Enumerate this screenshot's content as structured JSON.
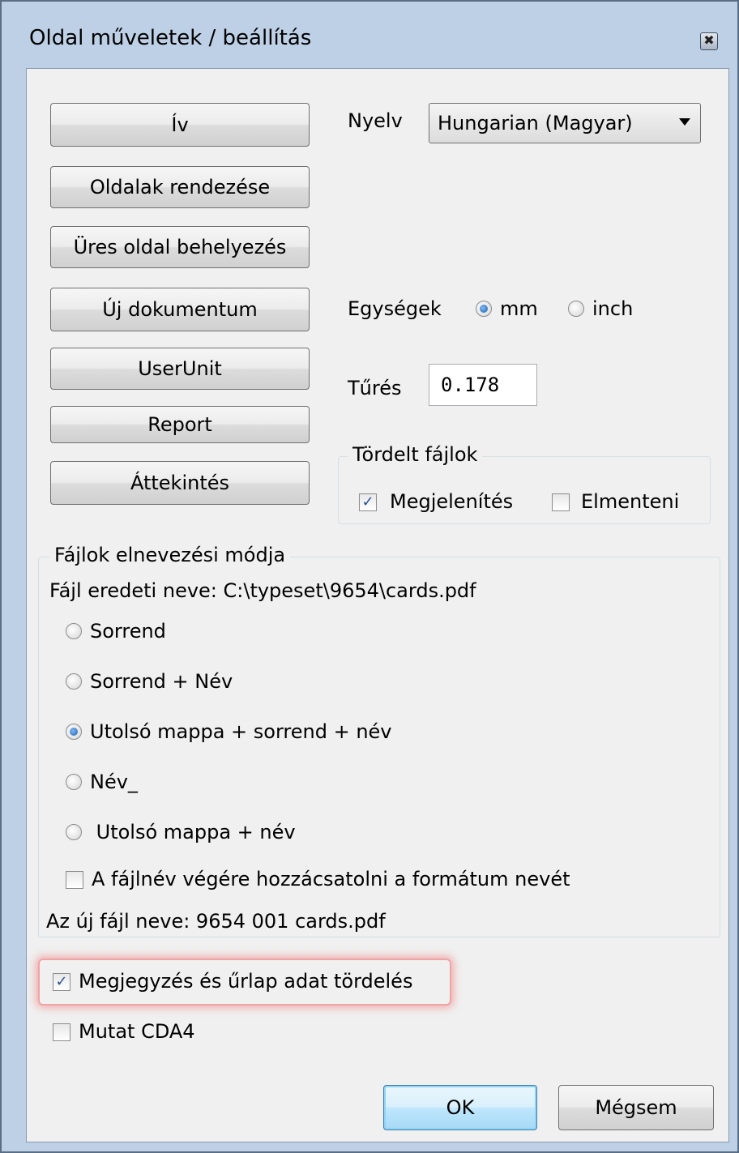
{
  "window": {
    "title": "Oldal műveletek / beállítás",
    "close_glyph": "✖"
  },
  "left_buttons": {
    "iv": "Ív",
    "sort_pages": "Oldalak rendezése",
    "insert_blank": "Üres oldal behelyezés",
    "new_document": "Új dokumentum",
    "userunit": "UserUnit",
    "report": "Report",
    "overview": "Áttekintés"
  },
  "language": {
    "label": "Nyelv",
    "value": "Hungarian (Magyar)"
  },
  "units": {
    "label": "Egységek",
    "options": [
      "mm",
      "inch"
    ],
    "selected": "mm"
  },
  "tolerance": {
    "label": "Tűrés",
    "value": "0.178"
  },
  "split_files": {
    "title": "Tördelt fájlok",
    "show_label": "Megjelenítés",
    "show_checked": true,
    "save_label": "Elmenteni",
    "save_checked": false
  },
  "naming": {
    "title": "Fájlok elnevezési módja",
    "original_name": "Fájl eredeti neve: C:\\typeset\\9654\\cards.pdf",
    "options": [
      "Sorrend",
      "Sorrend + Név",
      "Utolsó mappa + sorrend + név",
      "Név_",
      " Utolsó mappa + név"
    ],
    "selected_index": 2,
    "append_format_label": "A fájlnév végére hozzácsatolni a formátum nevét",
    "append_format_checked": false,
    "new_name": "Az új fájl neve: 9654 001 cards.pdf"
  },
  "annotations": {
    "label": "Megjegyzés és űrlap adat tördelés",
    "checked": true
  },
  "show_cda4": {
    "label": "Mutat CDA4",
    "checked": false
  },
  "footer": {
    "ok": "OK",
    "cancel": "Mégsem"
  },
  "colors": {
    "highlight": "#f07878",
    "title_bar": "#bdd0e6",
    "ok_button": "#bee6fd"
  },
  "check_glyph": "✓"
}
